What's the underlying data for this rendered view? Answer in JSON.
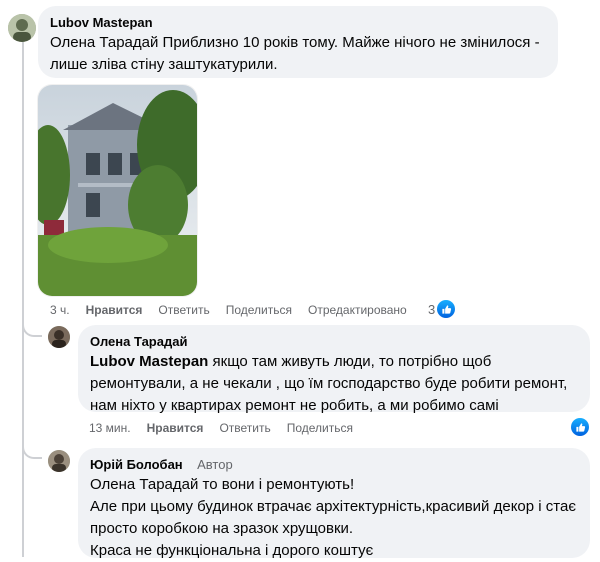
{
  "comments": [
    {
      "author": "Lubov Mastepan",
      "text": "Олена Тарадай Приблизно 10 років тому. Майже нічого не змінилося -\nлише зліва стіну заштукатурили.",
      "time": "3 ч.",
      "like": "Нравится",
      "reply": "Ответить",
      "share": "Поделиться",
      "edited": "Отредактировано",
      "reaction_count": "3"
    },
    {
      "author": "Олена Тарадай",
      "mention": "Lubov Mastepan",
      "text": " якщо там живуть люди, то потрібно щоб\nремонтували, а не чекали , що їм господарство буде робити ремонт,\nнам ніхто у квартирах ремонт не робить, а ми робимо самі",
      "time": "13 мин.",
      "like": "Нравится",
      "reply": "Ответить",
      "share": "Поделиться"
    },
    {
      "author": "Юрій Болобан",
      "author_tag": "Автор",
      "text": "Олена Тарадай то вони і ремонтують!\nАле при цьому будинок втрачає архітектурність,красивий декор і стає\nпросто коробкою на зразок хрущовки.\nКраса не функціональна і дорого коштує"
    }
  ],
  "icons": {
    "like": "like-icon",
    "photo": "house-photo"
  },
  "colors": {
    "bubble": "#f0f2f5",
    "like_blue": "#1877f2",
    "meta": "#65676b",
    "thread": "#ced0d4"
  }
}
